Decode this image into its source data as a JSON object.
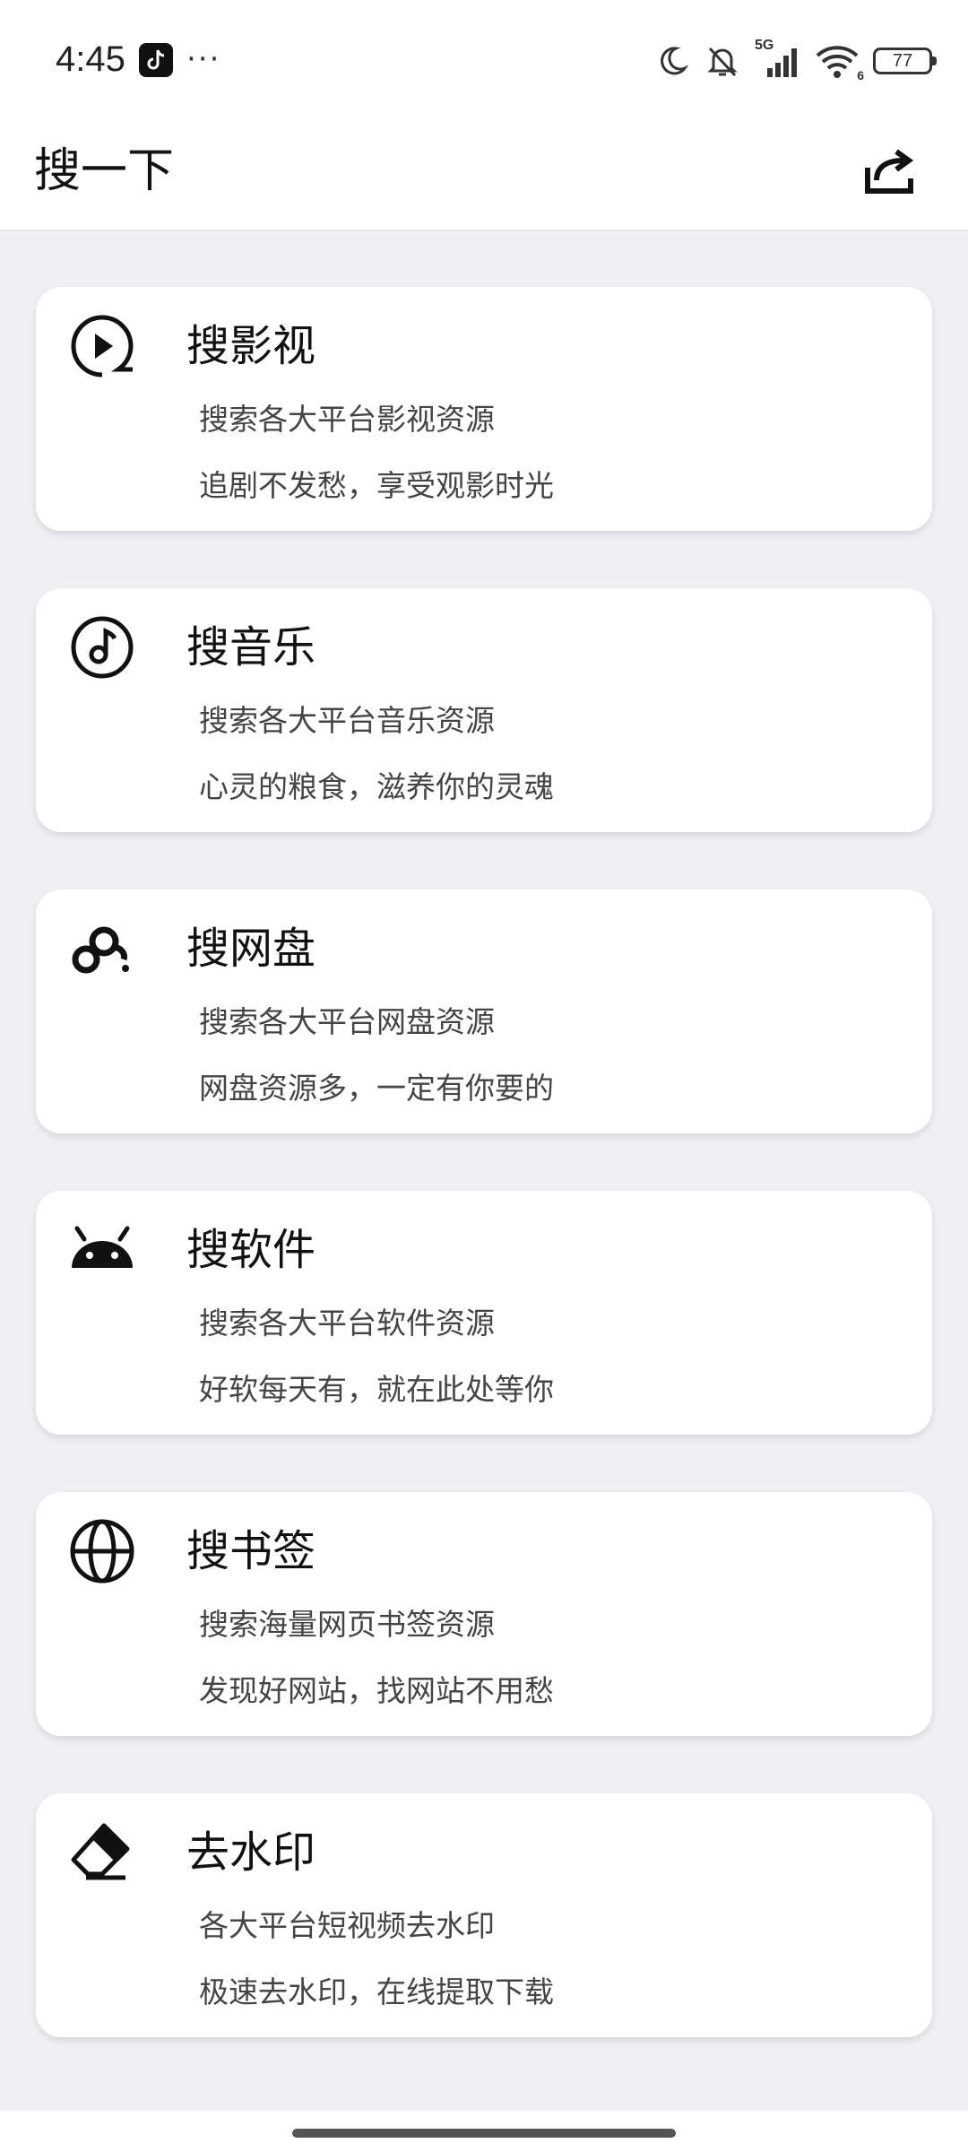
{
  "status_bar": {
    "time": "4:45",
    "dots": "···",
    "network": "5G",
    "wifi_badge": "6",
    "battery": "77",
    "icons": [
      "tiktok-icon",
      "moon-icon",
      "mute-bell-icon",
      "signal-icon",
      "wifi-icon",
      "battery-icon"
    ]
  },
  "app_bar": {
    "title": "搜一下",
    "share_icon": "share-icon"
  },
  "cards": [
    {
      "icon": "play-circle-icon",
      "title": "搜影视",
      "line1": "搜索各大平台影视资源",
      "line2": "追剧不发愁，享受观影时光"
    },
    {
      "icon": "music-note-icon",
      "title": "搜音乐",
      "line1": "搜索各大平台音乐资源",
      "line2": "心灵的粮食，滋养你的灵魂"
    },
    {
      "icon": "netdisk-cloud-icon",
      "title": "搜网盘",
      "line1": "搜索各大平台网盘资源",
      "line2": "网盘资源多，一定有你要的"
    },
    {
      "icon": "android-icon",
      "title": "搜软件",
      "line1": "搜索各大平台软件资源",
      "line2": "好软每天有，就在此处等你"
    },
    {
      "icon": "globe-icon",
      "title": "搜书签",
      "line1": "搜索海量网页书签资源",
      "line2": "发现好网站，找网站不用愁"
    },
    {
      "icon": "eraser-icon",
      "title": "去水印",
      "line1": "各大平台短视频去水印",
      "line2": "极速去水印，在线提取下载"
    }
  ],
  "colors": {
    "background": "#f0eff4",
    "card": "#ffffff",
    "text": "#111111",
    "subtext": "#444444"
  }
}
